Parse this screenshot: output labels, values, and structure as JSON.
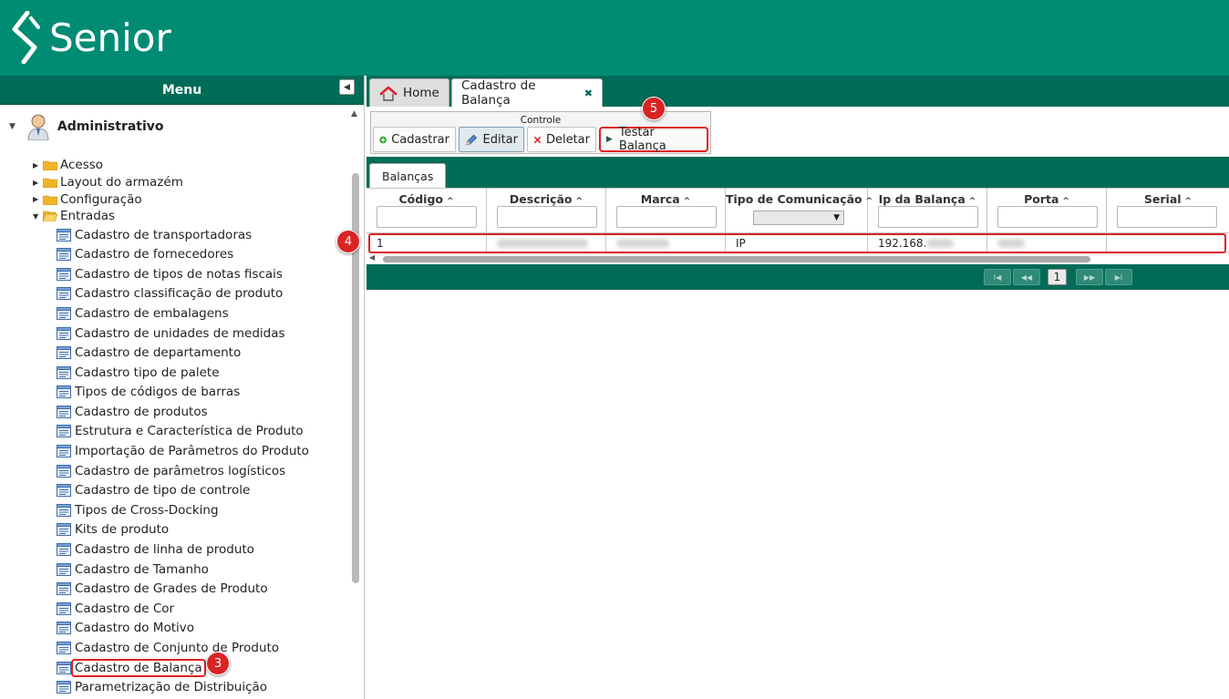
{
  "header": {
    "brand": "Senior"
  },
  "sidebar": {
    "menu_title": "Menu",
    "root": "Administrativo",
    "folders": [
      {
        "label": "Acesso",
        "open": false
      },
      {
        "label": "Layout do armazém",
        "open": false
      },
      {
        "label": "Configuração",
        "open": false
      },
      {
        "label": "Entradas",
        "open": true
      }
    ],
    "items": [
      "Cadastro de transportadoras",
      "Cadastro de fornecedores",
      "Cadastro de tipos de notas fiscais",
      "Cadastro classificação de produto",
      "Cadastro de embalagens",
      "Cadastro de unidades de medidas",
      "Cadastro de departamento",
      "Cadastro tipo de palete",
      "Tipos de códigos de barras",
      "Cadastro de produtos",
      "Estrutura e Característica de Produto",
      "Importação de Parâmetros do Produto",
      "Cadastro de parâmetros logísticos",
      "Cadastro de tipo de controle",
      "Tipos de Cross-Docking",
      "Kits de produto",
      "Cadastro de linha de produto",
      "Cadastro de Tamanho",
      "Cadastro de Grades de Produto",
      "Cadastro de Cor",
      "Cadastro do Motivo",
      "Cadastro de Conjunto de Produto",
      "Cadastro de Balança",
      "Parametrização de Distribuição"
    ],
    "selected_index": 22
  },
  "tabs": {
    "home": "Home",
    "active": "Cadastro de Balança",
    "close": "✖"
  },
  "toolbar": {
    "group_title": "Controle",
    "cadastrar": "Cadastrar",
    "editar": "Editar",
    "deletar": "Deletar",
    "testar": "Testar Balança"
  },
  "grid": {
    "tab": "Balanças",
    "columns": [
      "Código",
      "Descrição",
      "Marca",
      "Tipo de Comunicação",
      "Ip da Balança",
      "Porta",
      "Serial"
    ],
    "row": {
      "codigo": "1",
      "tipo": "IP",
      "ip": "192.168."
    },
    "page": "1"
  },
  "badges": {
    "b3": "3",
    "b4": "4",
    "b5": "5"
  },
  "colors": {
    "brand": "#008c73",
    "dark": "#006b57",
    "highlight": "#e02020"
  }
}
